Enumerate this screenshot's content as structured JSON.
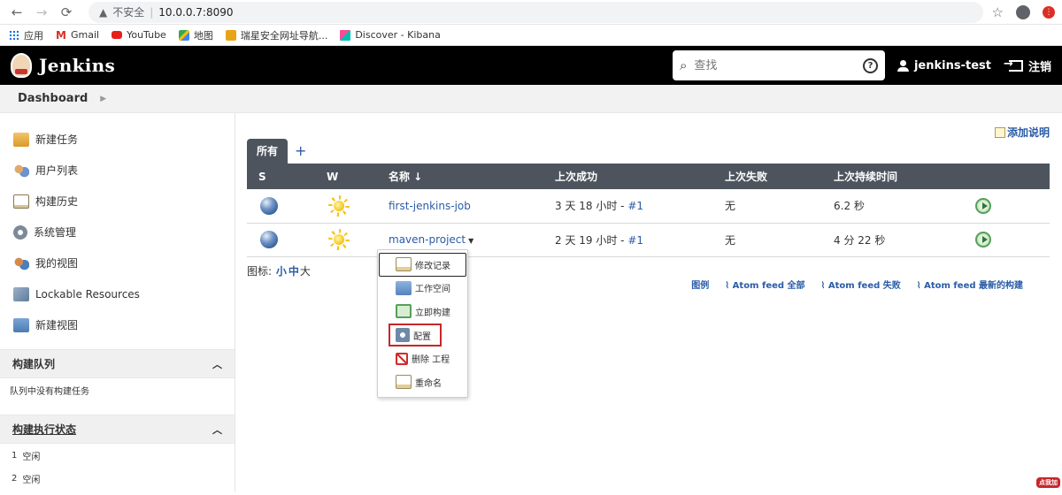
{
  "browser": {
    "security_label": "不安全",
    "url": "10.0.0.7:8090",
    "bookmarks": [
      {
        "label": "应用",
        "icon": "apps-grid-icon"
      },
      {
        "label": "Gmail",
        "icon": "gmail-icon"
      },
      {
        "label": "YouTube",
        "icon": "youtube-icon"
      },
      {
        "label": "地图",
        "icon": "maps-icon"
      },
      {
        "label": "瑞星安全网址导航...",
        "icon": "rising-icon"
      },
      {
        "label": "Discover - Kibana",
        "icon": "kibana-icon"
      }
    ]
  },
  "header": {
    "title": "Jenkins",
    "search_placeholder": "查找",
    "help_icon": "?",
    "user": "jenkins-test",
    "logout": "注销"
  },
  "breadcrumb": {
    "root": "Dashboard"
  },
  "sidebar": {
    "items": [
      {
        "label": "新建任务",
        "icon": "new-item-icon"
      },
      {
        "label": "用户列表",
        "icon": "users-icon"
      },
      {
        "label": "构建历史",
        "icon": "build-history-icon"
      },
      {
        "label": "系统管理",
        "icon": "gear-icon"
      },
      {
        "label": "我的视图",
        "icon": "my-views-icon"
      },
      {
        "label": "Lockable Resources",
        "icon": "lock-icon"
      },
      {
        "label": "新建视图",
        "icon": "folder-icon"
      }
    ],
    "build_queue": {
      "title": "构建队列",
      "empty_text": "队列中没有构建任务"
    },
    "executor_status": {
      "title": "构建执行状态",
      "executors": [
        {
          "num": "1",
          "state": "空闲"
        },
        {
          "num": "2",
          "state": "空闲"
        }
      ]
    }
  },
  "main": {
    "add_description": "添加说明",
    "tabs": [
      {
        "label": "所有",
        "active": true
      }
    ],
    "add_tab": "+",
    "table": {
      "headers": {
        "s": "S",
        "w": "W",
        "name": "名称 ↓",
        "last_success": "上次成功",
        "last_failure": "上次失败",
        "last_duration": "上次持续时间"
      },
      "rows": [
        {
          "name": "first-jenkins-job",
          "last_success_text": "3 天 18 小时 - ",
          "last_success_build": "#1",
          "last_failure": "无",
          "last_duration": "6.2 秒"
        },
        {
          "name": "maven-project",
          "last_success_text": "2 天 19 小时 - ",
          "last_success_build": "#1",
          "last_failure": "无",
          "last_duration": "4 分 22 秒"
        }
      ]
    },
    "icon_size": {
      "label": "图标:",
      "small": "小",
      "medium": "中",
      "large": "大"
    },
    "feeds": {
      "legend": "图例",
      "all": "Atom feed 全部",
      "failed": "Atom feed 失败",
      "latest": "Atom feed 最新的构建"
    }
  },
  "dropdown": {
    "items": [
      {
        "label": "修改记录",
        "icon": "changes-icon"
      },
      {
        "label": "工作空间",
        "icon": "workspace-icon"
      },
      {
        "label": "立即构建",
        "icon": "build-now-icon"
      },
      {
        "label": "配置",
        "icon": "configure-icon"
      },
      {
        "label": "删除 工程",
        "icon": "delete-icon"
      },
      {
        "label": "重命名",
        "icon": "rename-icon"
      }
    ]
  },
  "corner_badge": "点我加"
}
